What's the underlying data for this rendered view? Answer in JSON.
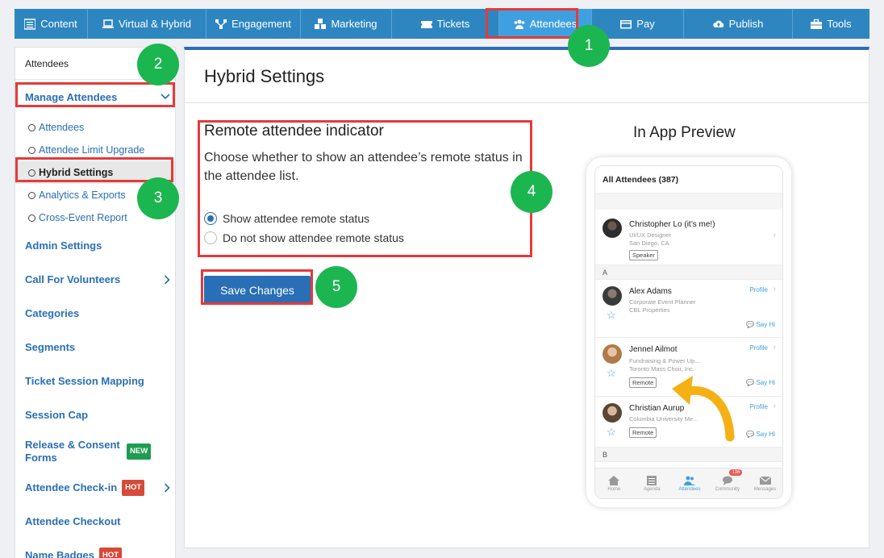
{
  "topnav": {
    "items": [
      {
        "label": "Content",
        "icon": "list-icon"
      },
      {
        "label": "Virtual & Hybrid",
        "icon": "laptop-icon"
      },
      {
        "label": "Engagement",
        "icon": "network-icon"
      },
      {
        "label": "Marketing",
        "icon": "cubes-icon"
      },
      {
        "label": "Tickets",
        "icon": "ticket-icon"
      },
      {
        "label": "Attendees",
        "icon": "users-icon"
      },
      {
        "label": "Pay",
        "icon": "card-icon"
      },
      {
        "label": "Publish",
        "icon": "cloud-upload-icon"
      },
      {
        "label": "Tools",
        "icon": "toolbox-icon"
      }
    ],
    "active": "Attendees"
  },
  "sidebar": {
    "top_label": "Attendees",
    "manage_label": "Manage Attendees",
    "sub_items": [
      "Attendees",
      "Attendee Limit Upgrade",
      "Hybrid Settings",
      "Analytics & Exports",
      "Cross-Event Report"
    ],
    "active_sub": "Hybrid Settings",
    "items": [
      {
        "label": "Admin Settings"
      },
      {
        "label": "Call For Volunteers",
        "chevron": true
      },
      {
        "label": "Categories"
      },
      {
        "label": "Segments"
      },
      {
        "label": "Ticket Session Mapping"
      },
      {
        "label": "Session Cap"
      },
      {
        "label": "Release & Consent Forms",
        "badge": "NEW"
      },
      {
        "label": "Attendee Check-in",
        "badge": "HOT",
        "chevron": true
      },
      {
        "label": "Attendee Checkout"
      },
      {
        "label": "Name Badges",
        "badge": "HOT"
      }
    ]
  },
  "main": {
    "title": "Hybrid Settings",
    "remote_title": "Remote attendee indicator",
    "remote_desc": "Choose whether to show an attendee’s remote status in the attendee list.",
    "options": [
      "Show attendee remote status",
      "Do not show attendee remote status"
    ],
    "selected_option": "Show attendee remote status",
    "save_label": "Save Changes"
  },
  "markers": [
    "1",
    "2",
    "3",
    "4",
    "5"
  ],
  "preview": {
    "title": "In App Preview",
    "header": "All Attendees (387)",
    "me": {
      "name": "Christopher Lo (it’s me!)",
      "line1": "UI/UX Designer",
      "line2": "San Diego, CA",
      "tag": "Speaker"
    },
    "section_a": "A",
    "section_b": "B",
    "people": [
      {
        "name": "Alex Adams",
        "line1": "Corporate Event Planner",
        "line2": "CBL Properties",
        "tag": ""
      },
      {
        "name": "Jennel Ailmot",
        "line1": "Fundraising & Power Up...",
        "line2": "Toronto Mass Choir, Inc.",
        "tag": "Remote"
      },
      {
        "name": "Christian Aurup",
        "line1": "Columbia University Me...",
        "line2": "",
        "tag": "Remote"
      }
    ],
    "profile_label": "Profile",
    "sayhi_label": "Say Hi",
    "tabs": [
      "Home",
      "Agenda",
      "Attendees",
      "Community",
      "Messages"
    ],
    "community_count": "136"
  },
  "colors": {
    "nav": "#2e86c1",
    "accent": "#2a6fb5",
    "highlight": "#e53a3a",
    "marker": "#1cb650",
    "arrow": "#f5b014"
  }
}
